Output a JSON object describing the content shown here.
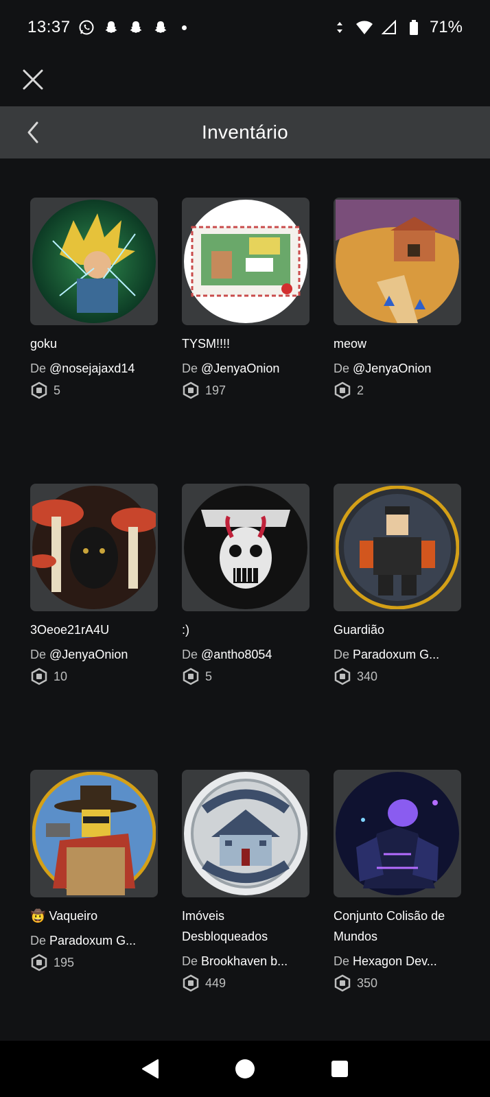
{
  "status_bar": {
    "time": "13:37",
    "battery": "71%",
    "notification_icons": [
      "whatsapp-icon",
      "snapchat-icon",
      "snapchat-icon",
      "snapchat-icon"
    ]
  },
  "header": {
    "title": "Inventário"
  },
  "creator_prefix": "De",
  "items": [
    {
      "name": "goku",
      "creator": "@nosejajaxd14",
      "price": "5",
      "thumb": "goku-image"
    },
    {
      "name": "TYSM!!!!",
      "creator": "@JenyaOnion",
      "price": "197",
      "thumb": "postcard-image"
    },
    {
      "name": "meow",
      "creator": "@JenyaOnion",
      "price": "2",
      "thumb": "cat-village-image"
    },
    {
      "name": "3Oeoe21rA4U",
      "creator": "@JenyaOnion",
      "price": "10",
      "thumb": "mushroom-cat-image"
    },
    {
      "name": ":)",
      "creator": "@antho8054",
      "price": "5",
      "thumb": "metallica-image"
    },
    {
      "name": "Guardião",
      "creator": "Paradoxum G...",
      "price": "340",
      "thumb": "guardian-image"
    },
    {
      "name": "🤠 Vaqueiro",
      "creator": "Paradoxum G...",
      "price": "195",
      "thumb": "cowboy-image"
    },
    {
      "name": "Imóveis Desbloqueados",
      "creator": "Brookhaven b...",
      "price": "449",
      "thumb": "estates-unlocked-image"
    },
    {
      "name": "Conjunto Colisão de Mundos",
      "creator": "Hexagon Dev...",
      "price": "350",
      "thumb": "worlds-collide-image"
    }
  ],
  "colors": {
    "background": "#111214",
    "header_bg": "#393b3d",
    "thumb_bg": "#393b3d",
    "secondary_text": "#bdbebe"
  }
}
